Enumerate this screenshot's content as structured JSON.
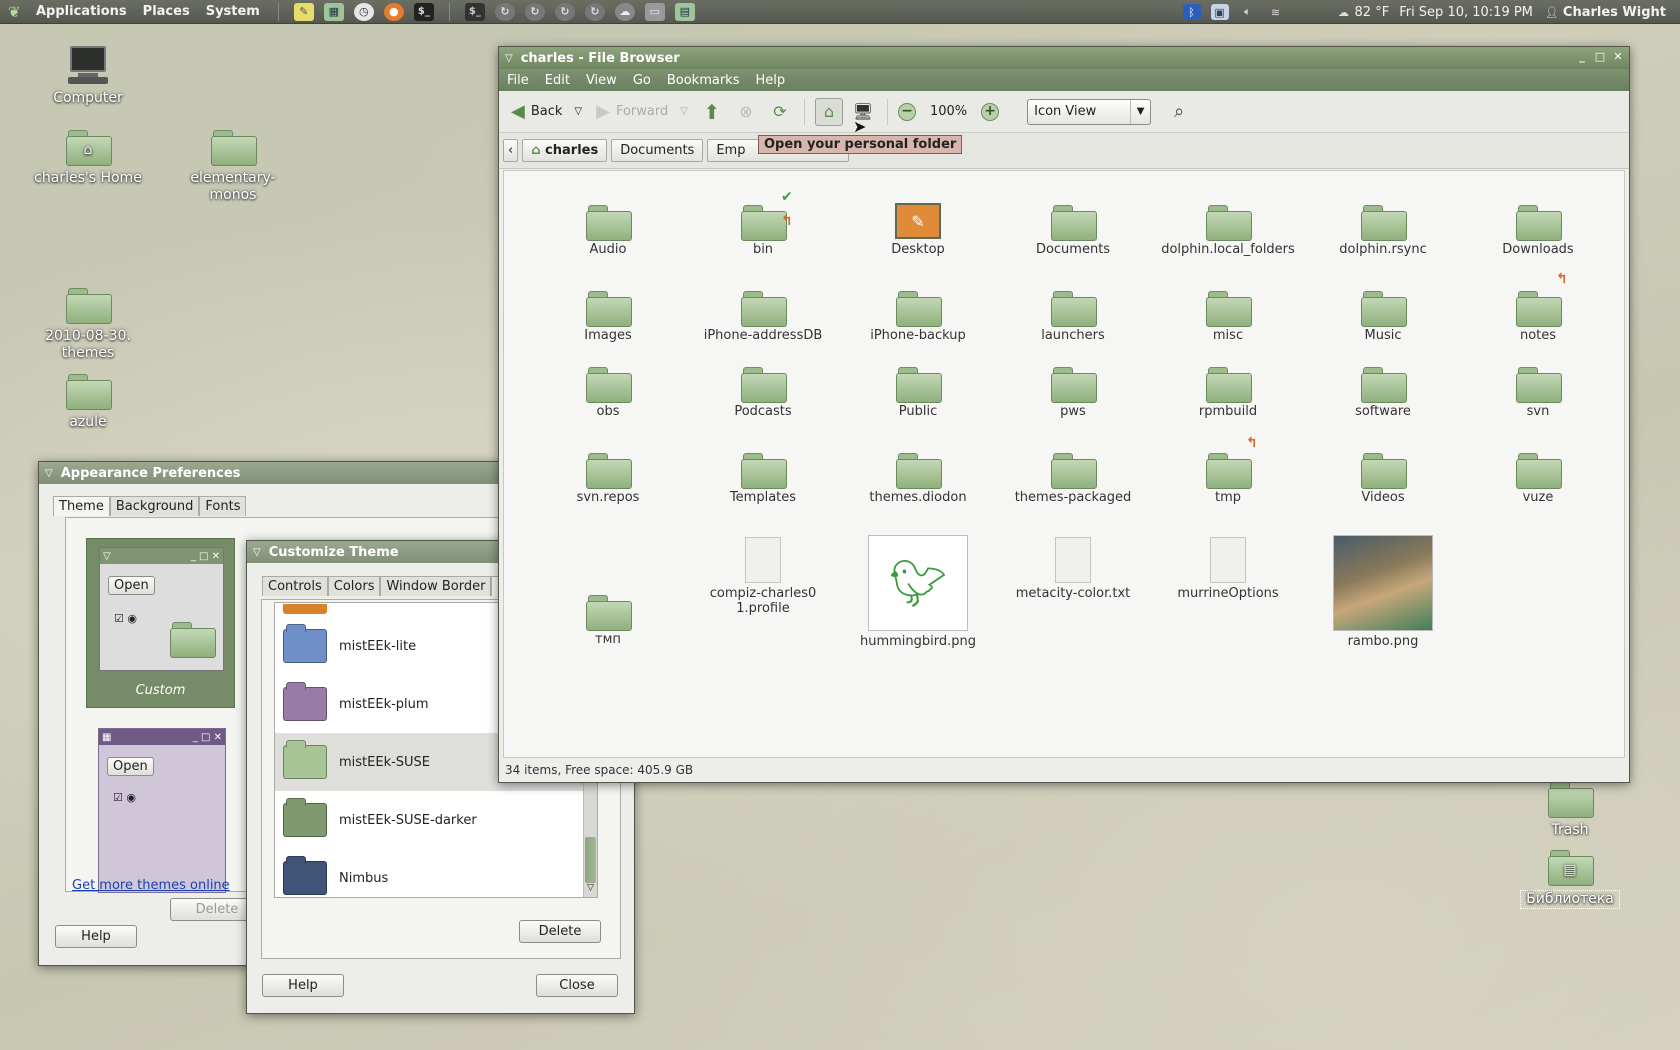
{
  "top_panel": {
    "menus": [
      "Applications",
      "Places",
      "System"
    ],
    "weather": "82 °F",
    "datetime": "Fri Sep 10, 10:19 PM",
    "user": "Charles Wight",
    "launcher_icons": [
      "notes-icon",
      "spreadsheet-icon",
      "clock-icon",
      "firefox-icon",
      "terminal-icon"
    ],
    "window_icons": [
      "terminal-window-icon",
      "sync-icon",
      "sync-icon",
      "sync-icon",
      "sync-icon",
      "cloud-icon",
      "desktop-icon",
      "document-icon"
    ],
    "tray_icons": [
      "bluetooth-icon",
      "network-icon",
      "volume-icon",
      "wifi-icon"
    ]
  },
  "desktop": {
    "icons": [
      {
        "label": "Computer",
        "icon": "computer-icon"
      },
      {
        "label": "charles's Home",
        "icon": "home-folder-icon"
      },
      {
        "label": "elementary-monos",
        "icon": "folder-icon"
      },
      {
        "label": "2010-08-30. themes",
        "icon": "folder-icon"
      },
      {
        "label": "azule",
        "icon": "folder-icon"
      },
      {
        "label": "Trash",
        "icon": "trash-icon"
      },
      {
        "label": "Библиотека",
        "icon": "folder-icon"
      }
    ]
  },
  "file_browser": {
    "title": "charles - File Browser",
    "menus": [
      "File",
      "Edit",
      "View",
      "Go",
      "Bookmarks",
      "Help"
    ],
    "toolbar": {
      "back": "Back",
      "forward": "Forward",
      "zoom": "100%",
      "view_mode": "Icon View"
    },
    "tooltip": "Open your personal folder",
    "path": [
      "charles",
      "Documents",
      "Emp"
    ],
    "files": [
      {
        "name": "Audio",
        "kind": "folder"
      },
      {
        "name": "bin",
        "kind": "folder"
      },
      {
        "name": "Desktop",
        "kind": "desktop"
      },
      {
        "name": "Documents",
        "kind": "folder"
      },
      {
        "name": "dolphin.local_folders",
        "kind": "folder"
      },
      {
        "name": "dolphin.rsync",
        "kind": "folder"
      },
      {
        "name": "Downloads",
        "kind": "folder"
      },
      {
        "name": "Images",
        "kind": "folder"
      },
      {
        "name": "iPhone-addressDB",
        "kind": "folder"
      },
      {
        "name": "iPhone-backup",
        "kind": "folder"
      },
      {
        "name": "launchers",
        "kind": "folder"
      },
      {
        "name": "misc",
        "kind": "folder"
      },
      {
        "name": "Music",
        "kind": "folder"
      },
      {
        "name": "notes",
        "kind": "folder"
      },
      {
        "name": "obs",
        "kind": "folder"
      },
      {
        "name": "Podcasts",
        "kind": "folder"
      },
      {
        "name": "Public",
        "kind": "folder"
      },
      {
        "name": "pws",
        "kind": "folder"
      },
      {
        "name": "rpmbuild",
        "kind": "folder"
      },
      {
        "name": "software",
        "kind": "folder"
      },
      {
        "name": "svn",
        "kind": "folder"
      },
      {
        "name": "svn.repos",
        "kind": "folder"
      },
      {
        "name": "Templates",
        "kind": "folder"
      },
      {
        "name": "themes.diodon",
        "kind": "folder"
      },
      {
        "name": "themes-packaged",
        "kind": "folder"
      },
      {
        "name": "tmp",
        "kind": "folder"
      },
      {
        "name": "Videos",
        "kind": "folder"
      },
      {
        "name": "vuze",
        "kind": "folder"
      },
      {
        "name": "тмп",
        "kind": "folder"
      },
      {
        "name": "compiz-charles01.profile",
        "kind": "file"
      },
      {
        "name": "hummingbird.png",
        "kind": "image"
      },
      {
        "name": "metacity-color.txt",
        "kind": "file"
      },
      {
        "name": "murrineOptions",
        "kind": "file"
      },
      {
        "name": "rambo.png",
        "kind": "image"
      }
    ],
    "status": "34 items, Free space: 405.9 GB"
  },
  "appearance": {
    "title": "Appearance Preferences",
    "tabs": [
      "Theme",
      "Background",
      "Fonts"
    ],
    "theme_label": "Custom",
    "open_label": "Open",
    "delete_label": "Delete",
    "more_link": "Get more themes online",
    "help_label": "Help"
  },
  "customize": {
    "title": "Customize Theme",
    "tabs": [
      "Controls",
      "Colors",
      "Window Border",
      "Ico"
    ],
    "icon_themes": [
      {
        "name": "mistEEk-lite",
        "color": "#6f8fc9"
      },
      {
        "name": "mistEEk-plum",
        "color": "#9a7aa6"
      },
      {
        "name": "mistEEk-SUSE",
        "color": "#a8c596"
      },
      {
        "name": "mistEEk-SUSE-darker",
        "color": "#7f9a70"
      },
      {
        "name": "Nimbus",
        "color": "#3f5577"
      }
    ],
    "selected_theme": "mistEEk-SUSE",
    "delete_label": "Delete",
    "help_label": "Help",
    "close_label": "Close"
  },
  "colors": {
    "accent": "#6f8761",
    "panel": "#5a5e55",
    "tooltip_bg": "#d8b6ad"
  }
}
